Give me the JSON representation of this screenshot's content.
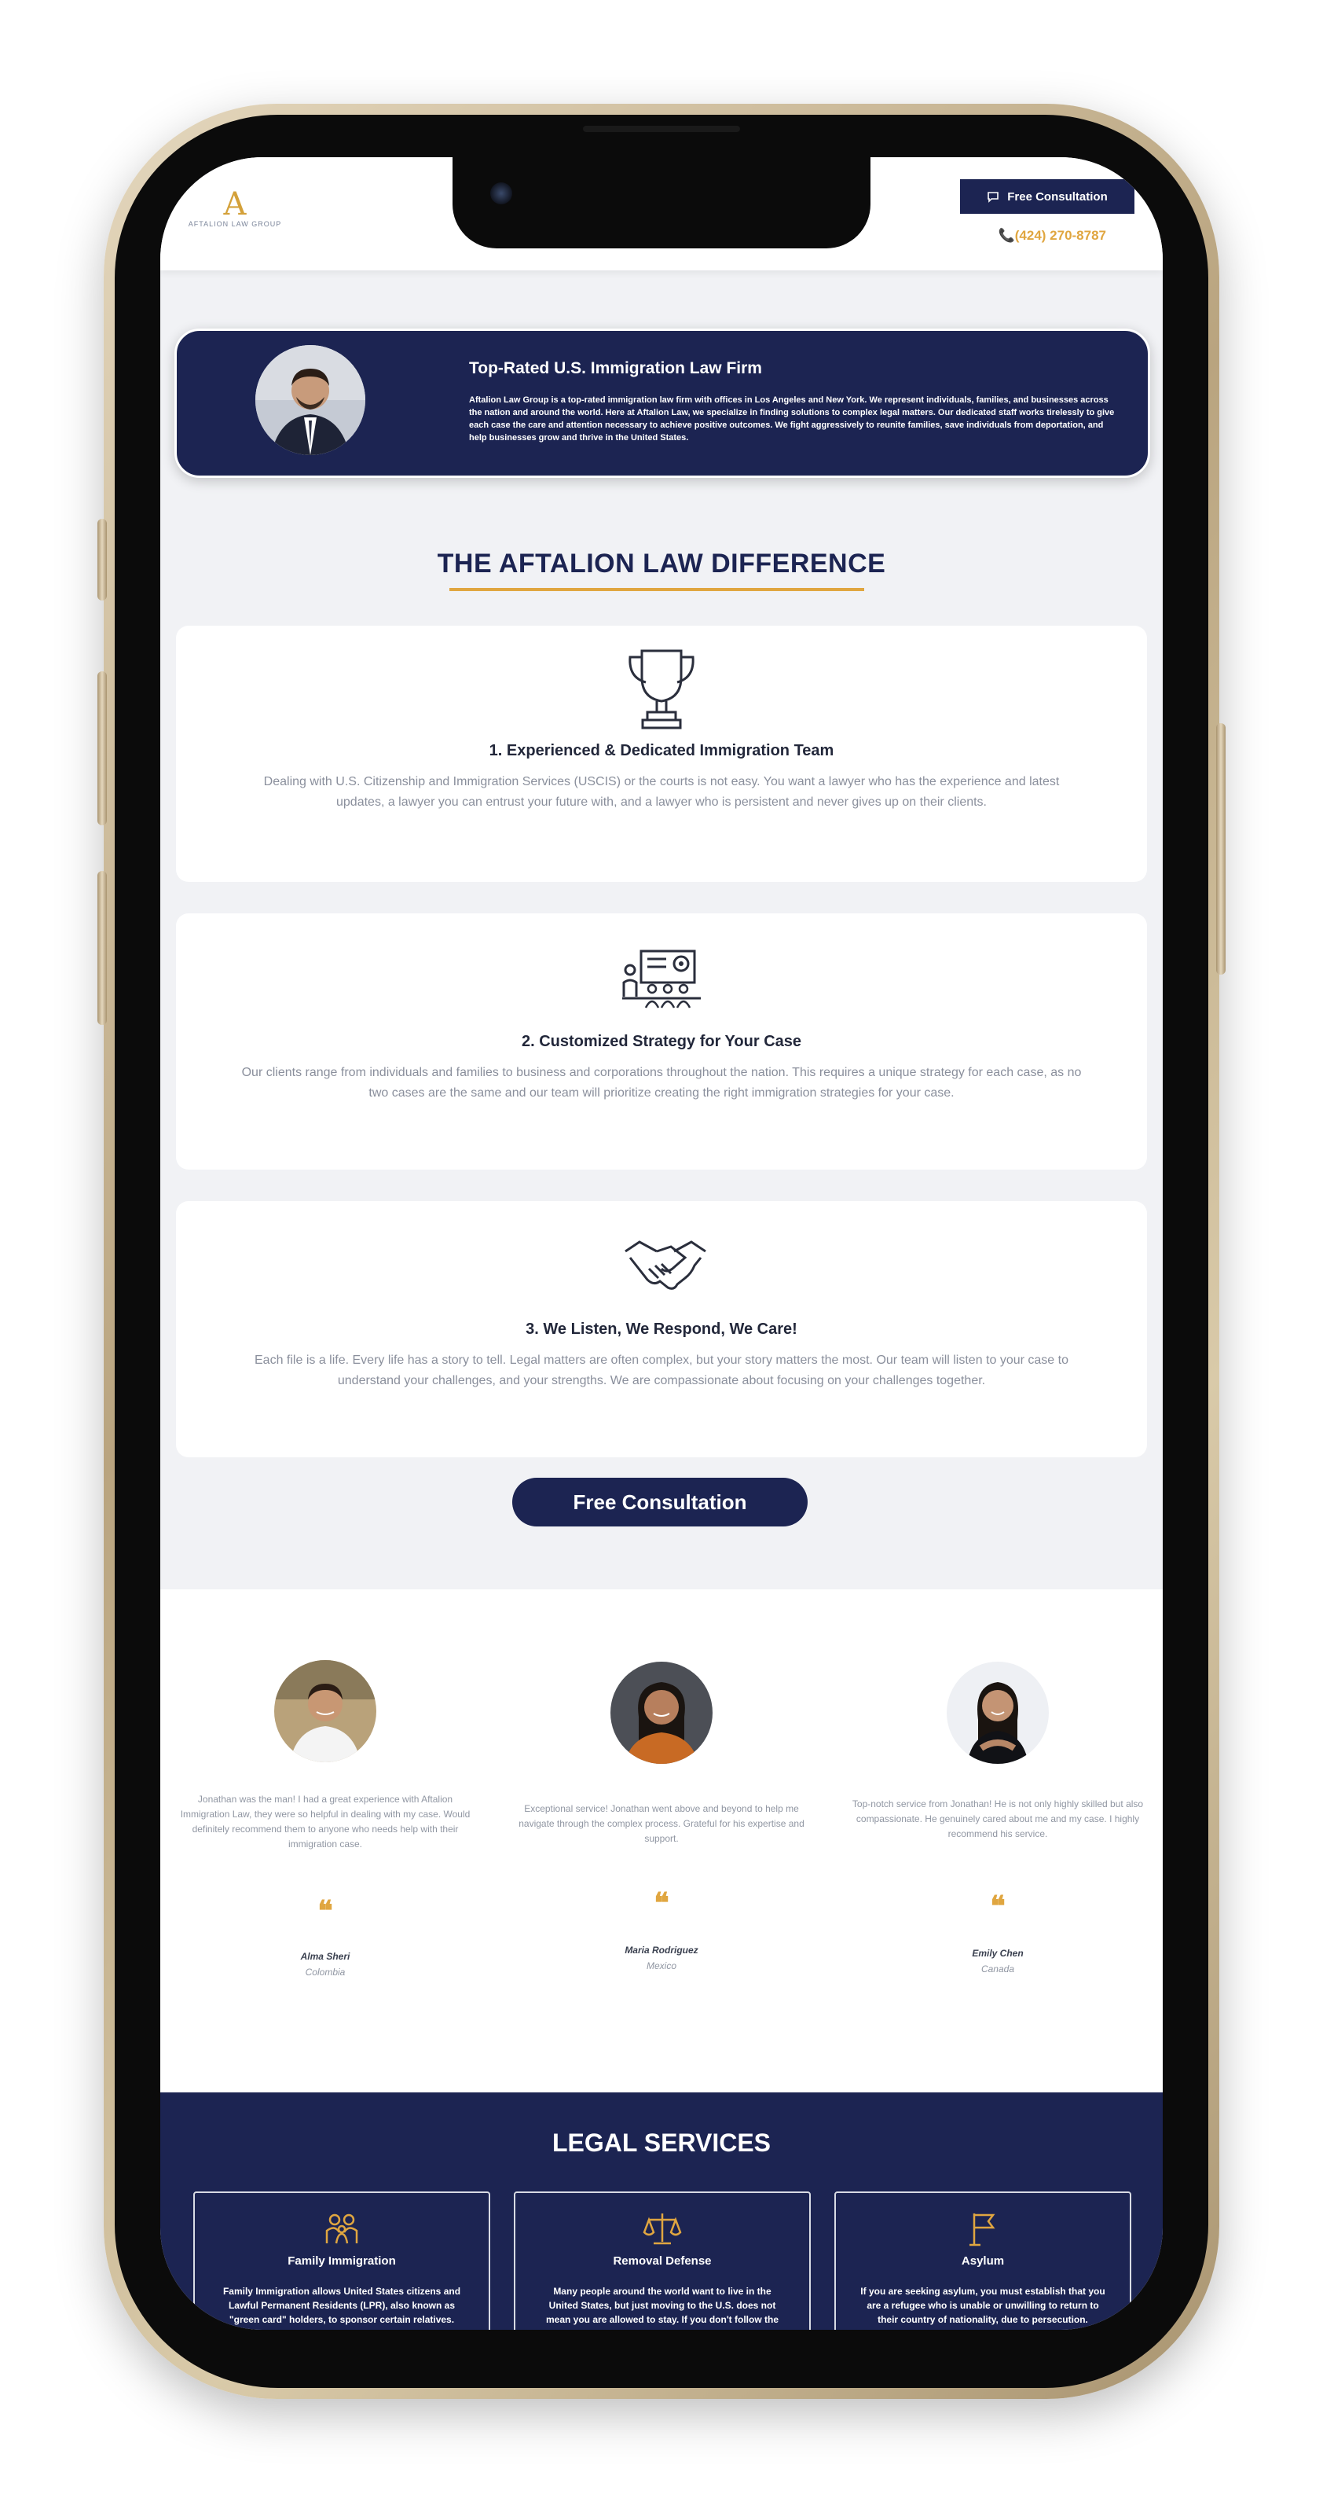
{
  "header": {
    "logo_mark": "A",
    "logo_text": "AFTALION LAW GROUP",
    "consult_label": "Free Consultation",
    "phone": "📞(424) 270-8787"
  },
  "hero": {
    "title": "Top-Rated U.S. Immigration Law Firm",
    "description": "Aftalion Law Group is a top-rated immigration law firm with offices in Los Angeles and New York. We represent individuals, families, and businesses across the nation and around the world. Here at Aftalion Law, we specialize in finding solutions to complex legal matters. Our dedicated staff works tirelessly to give each case the care and attention necessary to achieve positive outcomes. We fight aggressively to reunite families, save individuals from deportation, and help businesses grow and thrive in the United States."
  },
  "difference": {
    "title": "THE AFTALION LAW DIFFERENCE",
    "items": [
      {
        "title": "1. Experienced & Dedicated Immigration Team",
        "text": "Dealing with U.S. Citizenship and Immigration Services (USCIS) or the courts is not easy. You want a lawyer who has the experience and latest updates, a lawyer you can entrust your future with, and a lawyer who is persistent and never gives up on their clients.",
        "icon": "trophy-icon"
      },
      {
        "title": "2. Customized Strategy for Your Case",
        "text": "Our clients range from individuals and families to business and corporations throughout the nation. This requires a unique strategy for each case, as no two cases are the same and our team will prioritize creating the right immigration strategies for your case.",
        "icon": "strategy-presentation-icon"
      },
      {
        "title": "3. We Listen, We Respond, We Care!",
        "text": "Each file is a life. Every life has a story to tell. Legal matters are often complex, but your story matters the most. Our team will listen to your case to understand your challenges, and your strengths. We are compassionate about focusing on your challenges together.",
        "icon": "handshake-icon"
      }
    ],
    "cta_label": "Free Consultation"
  },
  "testimonials": [
    {
      "text": "Jonathan was the man! I had a great experience with Aftalion Immigration Law, they were so helpful in dealing with my case. Would definitely recommend them to anyone who needs help with their immigration case.",
      "quote_mark": "❝",
      "name": "Alma Sheri",
      "country": "Colombia"
    },
    {
      "text": "Exceptional service! Jonathan went above and beyond to help me navigate through the complex process. Grateful for his expertise and support.",
      "quote_mark": "❝",
      "name": "Maria Rodriguez",
      "country": "Mexico"
    },
    {
      "text": "Top-notch service from Jonathan! He is not only highly skilled but also compassionate. He genuinely cared about me and my case. I highly recommend his service.",
      "quote_mark": "❝",
      "name": "Emily Chen",
      "country": "Canada"
    }
  ],
  "legal_services": {
    "title": "LEGAL SERVICES",
    "items": [
      {
        "title": "Family Immigration",
        "text": "Family Immigration allows United States citizens and Lawful Permanent Residents (LPR), also known as \"green card\" holders, to sponsor certain relatives.",
        "icon": "family-icon"
      },
      {
        "title": "Removal Defense",
        "text": "Many people around the world want to live in the United States, but just moving to the U.S. does not mean you are allowed to stay. If you don't follow the rules.",
        "icon": "scales-icon"
      },
      {
        "title": "Asylum",
        "text": "If you are seeking asylum, you must establish that you are a refugee who is unable or unwilling to return to their country of nationality, due to persecution.",
        "icon": "flag-icon"
      }
    ]
  },
  "colors": {
    "navy": "#1c2452",
    "gold": "#e0a640",
    "page_bg": "#f1f2f5"
  }
}
